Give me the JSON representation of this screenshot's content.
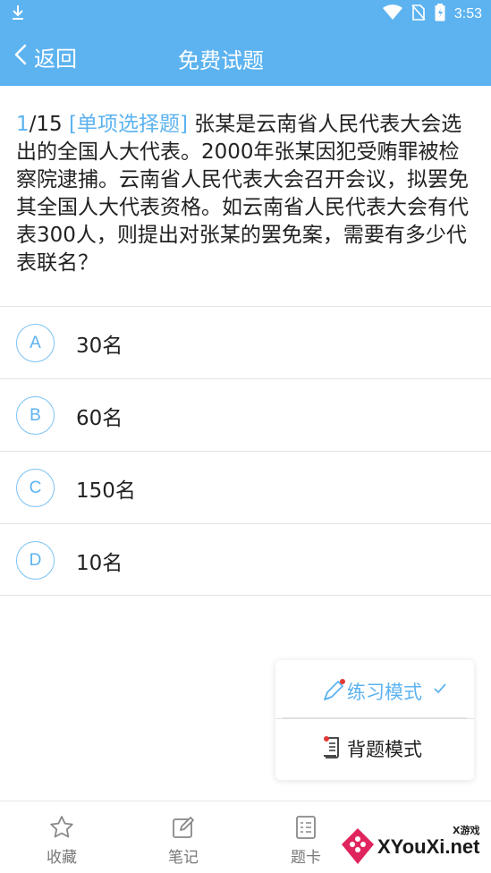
{
  "status_bar": {
    "time": "3:53"
  },
  "app_bar": {
    "back_label": "返回",
    "title": "免费试题"
  },
  "question": {
    "index": "1",
    "total": "/15",
    "type_tag": "[单项选择题]",
    "text": " 张某是云南省人民代表大会选出的全国人大代表。2000年张某因犯受贿罪被检察院逮捕。云南省人民代表大会召开会议，拟罢免其全国人大代表资格。如云南省人民代表大会有代表300人，则提出对张某的罢免案，需要有多少代表联名？"
  },
  "options": [
    {
      "letter": "A",
      "text": "30名"
    },
    {
      "letter": "B",
      "text": "60名"
    },
    {
      "letter": "C",
      "text": "150名"
    },
    {
      "letter": "D",
      "text": "10名"
    }
  ],
  "mode_menu": {
    "practice": "练习模式",
    "memorize": "背题模式",
    "selected": "practice"
  },
  "bottom_nav": {
    "favorite": "收藏",
    "notes": "笔记",
    "answer_card": "题卡"
  },
  "watermark": {
    "text": "XYouXi.net",
    "small": "X游戏"
  },
  "colors": {
    "primary": "#5cb3f0",
    "text": "#222222",
    "divider": "#e2e2e2"
  }
}
